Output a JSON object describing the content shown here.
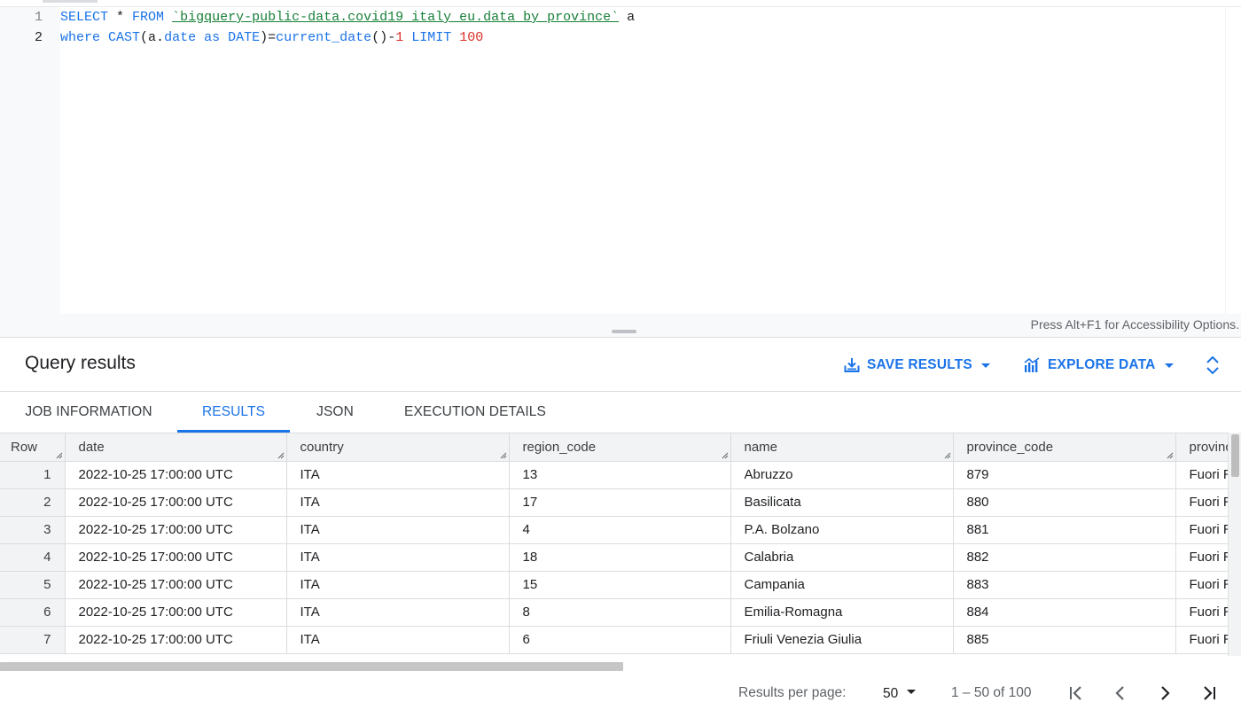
{
  "editor": {
    "line_numbers": [
      "1",
      "2"
    ],
    "line1": {
      "select": "SELECT",
      "star": " * ",
      "from": "FROM",
      "space": " ",
      "table": "`bigquery-public-data.covid19_italy_eu.data_by_province`",
      "alias": " a"
    },
    "line2": {
      "where": "where",
      "sp1": " ",
      "cast": "CAST",
      "open": "(a.",
      "date_field": "date",
      "sp2": " ",
      "as": "as",
      "sp3": " ",
      "date_type": "DATE",
      "close_eq": ")=",
      "current_date": "current_date",
      "parens_minus": "()-",
      "one": "1",
      "sp4": " ",
      "limit": "LIMIT",
      "sp5": " ",
      "limit_val": "100"
    },
    "accessibility_hint": "Press Alt+F1 for Accessibility Options."
  },
  "results_header": {
    "title": "Query results",
    "save_results_label": "SAVE RESULTS",
    "explore_data_label": "EXPLORE DATA"
  },
  "tabs": [
    {
      "label": "JOB INFORMATION",
      "active": false
    },
    {
      "label": "RESULTS",
      "active": true
    },
    {
      "label": "JSON",
      "active": false
    },
    {
      "label": "EXECUTION DETAILS",
      "active": false
    }
  ],
  "table": {
    "columns": [
      "Row",
      "date",
      "country",
      "region_code",
      "name",
      "province_code",
      "province_name"
    ],
    "rows": [
      [
        "1",
        "2022-10-25 17:00:00 UTC",
        "ITA",
        "13",
        "Abruzzo",
        "879",
        "Fuori Regione / Provincia Autonoma"
      ],
      [
        "2",
        "2022-10-25 17:00:00 UTC",
        "ITA",
        "17",
        "Basilicata",
        "880",
        "Fuori Regione / Provincia Autonoma"
      ],
      [
        "3",
        "2022-10-25 17:00:00 UTC",
        "ITA",
        "4",
        "P.A. Bolzano",
        "881",
        "Fuori Regione / Provincia Autonoma"
      ],
      [
        "4",
        "2022-10-25 17:00:00 UTC",
        "ITA",
        "18",
        "Calabria",
        "882",
        "Fuori Regione / Provincia Autonoma"
      ],
      [
        "5",
        "2022-10-25 17:00:00 UTC",
        "ITA",
        "15",
        "Campania",
        "883",
        "Fuori Regione / Provincia Autonoma"
      ],
      [
        "6",
        "2022-10-25 17:00:00 UTC",
        "ITA",
        "8",
        "Emilia-Romagna",
        "884",
        "Fuori Regione / Provincia Autonoma"
      ],
      [
        "7",
        "2022-10-25 17:00:00 UTC",
        "ITA",
        "6",
        "Friuli Venezia Giulia",
        "885",
        "Fuori Regione / Provincia Autonoma"
      ]
    ]
  },
  "pagination": {
    "results_per_page_label": "Results per page:",
    "results_per_page_value": "50",
    "range": "1 – 50 of 100"
  },
  "colors": {
    "accent": "#1a73e8",
    "string": "#188038",
    "number": "#d93025"
  }
}
